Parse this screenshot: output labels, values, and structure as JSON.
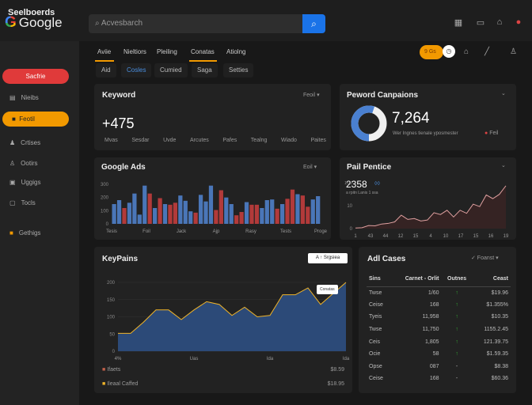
{
  "header": {
    "logo": "Google",
    "search_placeholder": "Acvesbarch",
    "icons": [
      "apps-icon",
      "window-icon",
      "store-icon",
      "avatar-notification-icon"
    ]
  },
  "sidebar": {
    "title": "Seelboerds",
    "items": [
      {
        "label": "Sacfrie",
        "icon": "none",
        "style": "red"
      },
      {
        "label": "Nieibs",
        "icon": "grid-icon"
      },
      {
        "label": "Feotil",
        "icon": "bag-icon",
        "style": "orange"
      },
      {
        "label": "Crtises",
        "icon": "person-icon"
      },
      {
        "label": "Ootirs",
        "icon": "user-icon"
      },
      {
        "label": "Uggigs",
        "icon": "image-icon"
      },
      {
        "label": "Tocls",
        "icon": "tools-icon"
      },
      {
        "label": "Gethigs",
        "icon": "settings-icon",
        "style": "orange-icon"
      }
    ]
  },
  "tabs": [
    "Aviie",
    "Nieltiors",
    "Pleiling",
    "Conatas",
    "Atiolng"
  ],
  "subtabs": [
    "Aid",
    "Cosles",
    "Cumied",
    "Saga",
    "Setties"
  ],
  "toolbar": {
    "badge": "9 Gs",
    "icons": [
      "clock-icon",
      "bookmark-icon",
      "edit-icon",
      "account-icon"
    ]
  },
  "keyword": {
    "title": "Keyword",
    "filter": "Feoil",
    "value": "+475",
    "labels": [
      "Mvas",
      "Sesdar",
      "Uvde",
      "Arcutes",
      "Pafes",
      "Tealng",
      "Wiado",
      "Paites"
    ]
  },
  "campaigns": {
    "title": "Peword Canpaions",
    "value": "7,264",
    "caption": "Wer Ingnes tienale yposmester",
    "legend": "Feil",
    "donut_fraction": 0.55,
    "colors": {
      "primary": "#4a80d0",
      "secondary": "#f0f0f0"
    }
  },
  "ads": {
    "title": "Google Ads",
    "filter": "Eoil"
  },
  "paid": {
    "title": "Pail Pentice",
    "value": "2358",
    "badge": "◊◊",
    "sub": "a rpitn Lanis 1 ssa"
  },
  "keypains": {
    "title": "KeyPains",
    "button": "A ↑ Srgsiea",
    "tooltip": "Conatas",
    "legend": [
      {
        "label": "Ifaets",
        "value": "$8.59",
        "color": "#c0604a"
      },
      {
        "label": "Ileaal Caffed",
        "value": "$18.95",
        "color": "#f0b429"
      }
    ]
  },
  "cases": {
    "title": "Adl Cases",
    "filter": "✓ Foanst",
    "columns": [
      "Sins",
      "Carnet - Orlit",
      "Outnes",
      "Ceast"
    ],
    "rows": [
      [
        "Twse",
        "1/60",
        "↑",
        "$19.96"
      ],
      [
        "Ceise",
        "168",
        "↑",
        "$1.355%"
      ],
      [
        "Tyeis",
        "11,958",
        "↑",
        "$10.35"
      ],
      [
        "Twse",
        "11,750",
        "↑",
        "1155.2.45"
      ],
      [
        "Ceis",
        "1,805",
        "↑",
        "121.39.75"
      ],
      [
        "Ocie",
        "58",
        "↑",
        "$1.59.35"
      ],
      [
        "Opse",
        "087",
        "-",
        "$8.38"
      ],
      [
        "Ceise",
        "168",
        "-",
        "$60.36"
      ]
    ]
  },
  "chart_data": [
    {
      "type": "bar",
      "title": "Google Ads",
      "yticks": [
        "0",
        "100",
        "200",
        "300"
      ],
      "ylim": [
        0,
        300
      ],
      "xticks": [
        "Tesis",
        "Foil",
        "Jack",
        "Ajp",
        "Rasy",
        "Tests",
        "Proge"
      ],
      "series": [
        {
          "color": "#4a76b8"
        },
        {
          "color": "#b23a3a"
        }
      ],
      "values": [
        150,
        180,
        120,
        160,
        230,
        70,
        290,
        230,
        120,
        195,
        150,
        145,
        160,
        215,
        175,
        95,
        85,
        220,
        170,
        290,
        105,
        255,
        200,
        150,
        65,
        90,
        165,
        145,
        145,
        120,
        180,
        185,
        115,
        150,
        190,
        260,
        225,
        215,
        130,
        185,
        210
      ],
      "colors": [
        0,
        0,
        1,
        0,
        0,
        0,
        0,
        1,
        0,
        1,
        0,
        1,
        1,
        0,
        0,
        0,
        1,
        0,
        0,
        0,
        1,
        1,
        0,
        0,
        1,
        1,
        0,
        1,
        1,
        0,
        0,
        0,
        1,
        0,
        1,
        1,
        0,
        1,
        1,
        0,
        0
      ]
    },
    {
      "type": "line",
      "title": "Pail Pentice",
      "yticks": [
        "0",
        "10",
        "100"
      ],
      "xticks": [
        "1",
        "43",
        "44",
        "12",
        "15",
        "4",
        "10",
        "17",
        "15",
        "16",
        "19"
      ],
      "ylim": [
        0,
        150
      ],
      "color": "#e0a0a0",
      "values": [
        2,
        3,
        10,
        9,
        15,
        17,
        22,
        44,
        30,
        33,
        25,
        28,
        52,
        46,
        60,
        38,
        60,
        50,
        80,
        72,
        110,
        98,
        112,
        140
      ]
    },
    {
      "type": "area",
      "title": "KeyPains",
      "yticks": [
        "0",
        "50",
        "100",
        "150",
        "200"
      ],
      "xticks": [
        "4%",
        "Uas",
        "Ida",
        "Ida"
      ],
      "ylim": [
        0,
        250
      ],
      "color": "#f0b429",
      "fill": "#2c4a78",
      "values": [
        65,
        65,
        105,
        150,
        150,
        115,
        150,
        180,
        170,
        130,
        160,
        125,
        130,
        205,
        205,
        230,
        170,
        210,
        250
      ]
    }
  ]
}
